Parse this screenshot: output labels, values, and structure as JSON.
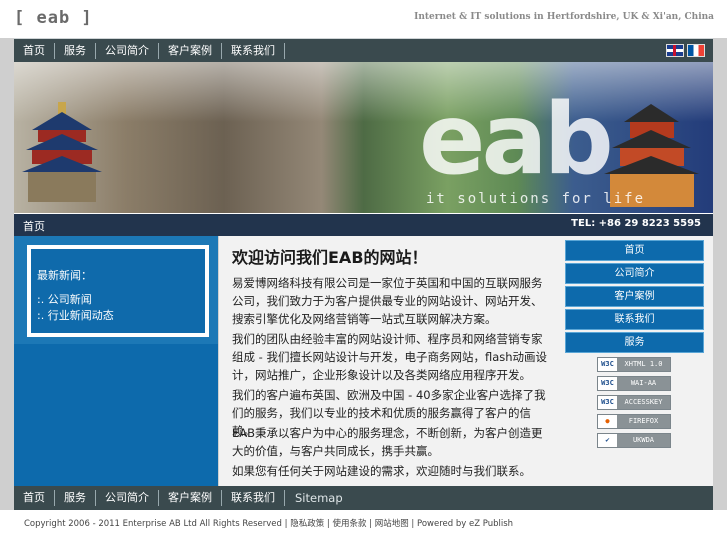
{
  "header": {
    "logo": "[ eab ]",
    "tagline": "Internet & IT solutions in Hertfordshire, UK & Xi'an, China"
  },
  "nav": {
    "items": [
      "首页",
      "服务",
      "公司简介",
      "客户案例",
      "联系我们"
    ],
    "flags": [
      "uk-flag-icon",
      "fr-flag-icon"
    ]
  },
  "banner": {
    "brand": "eab",
    "slogan": "it solutions for life"
  },
  "infobar": {
    "breadcrumb": "首页",
    "tel": "TEL: +86  29  8223 5595"
  },
  "sidebar": {
    "title": "最新新闻：",
    "items": [
      ":. 公司新闻",
      ":. 行业新闻动态"
    ]
  },
  "main": {
    "title": "欢迎访问我们EAB的网站！",
    "paragraphs": [
      "易爱博网络科技有限公司是一家位于英国和中国的互联网服务公司，我们致力于为客户提供最专业的网站设计、网站开发、搜索引擎优化及网络营销等一站式互联网解决方案。",
      "我们的团队由经验丰富的网站设计师、程序员和网络营销专家组成 - 我们擅长网站设计与开发，电子商务网站，flash动画设计，网站推广，企业形象设计以及各类网络应用程序开发。",
      "我们的客户遍布英国、欧洲及中国 - 40多家企业客户选择了我们的服务，我们以专业的技术和优质的服务赢得了客户的信赖。",
      "EAB秉承以客户为中心的服务理念，不断创新，为客户创造更大的价值，与客户共同成长，携手共赢。",
      "如果您有任何关于网站建设的需求，欢迎随时与我们联系。"
    ]
  },
  "rightnav": {
    "buttons": [
      "首页",
      "公司简介",
      "客户案例",
      "联系我们",
      "服务"
    ]
  },
  "badges": [
    {
      "icon": "w3c-icon",
      "text": "XHTML 1.0"
    },
    {
      "icon": "w3c-icon",
      "text": "WAI-AA"
    },
    {
      "icon": "w3c-icon",
      "text": "ACCESSKEY"
    },
    {
      "icon": "firefox-icon",
      "text": "FIREFOX"
    },
    {
      "icon": "check-icon",
      "text": "UKWDA"
    }
  ],
  "footer": {
    "nav": [
      "首页",
      "服务",
      "公司简介",
      "客户案例",
      "联系我们"
    ],
    "sitemap": "Sitemap",
    "copyright": "Copyright 2006 - 2011 Enterprise AB Ltd All Rights Reserved | 隐私政策 | 使用条款 | 网站地图 | Powered by eZ Publish"
  }
}
